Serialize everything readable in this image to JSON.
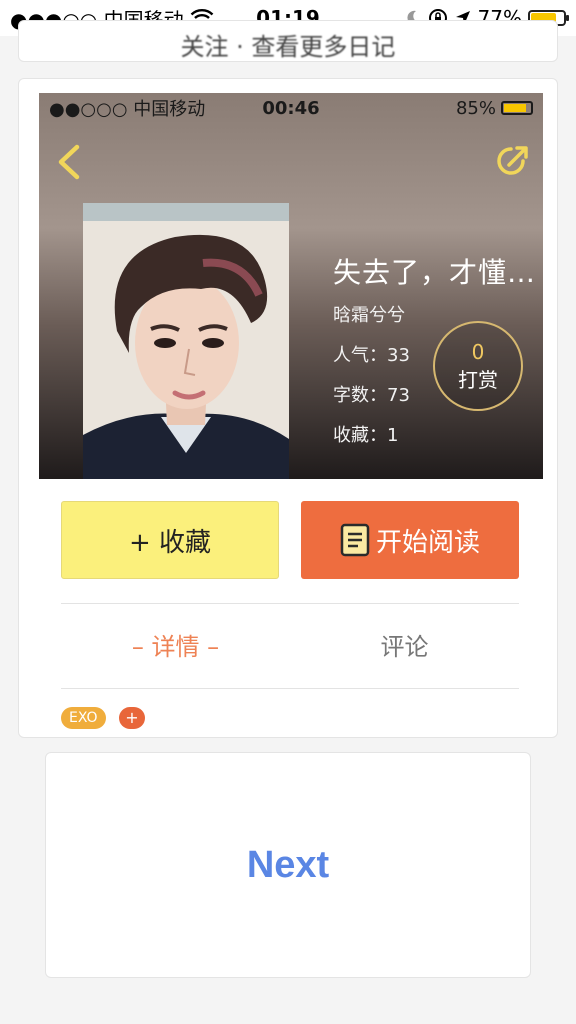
{
  "status_bar": {
    "carrier": "●●●○○ 中国移动",
    "time": "01:19",
    "battery": "77%",
    "battery_level": 0.77
  },
  "top_card": {
    "text": "关注 · 查看更多日记"
  },
  "inner_screenshot": {
    "status_bar": {
      "carrier": "●●○○○ 中国移动",
      "time": "00:46",
      "battery": "85%",
      "battery_level": 0.85
    },
    "book": {
      "title": "失去了，才懂…",
      "author": "晗霜兮兮",
      "popularity_label": "人气：",
      "popularity": "33",
      "words_label": "字数：",
      "words": "73",
      "favorites_label": "收藏：",
      "favorites": "1"
    },
    "reward": {
      "count": "0",
      "label": "打赏"
    }
  },
  "actions": {
    "favorite": "+ 收藏",
    "start_reading": "开始阅读"
  },
  "tabs": {
    "detail": "– 详情 –",
    "comments": "评论"
  },
  "tags": {
    "items": [
      "EXO"
    ],
    "add": "+"
  },
  "next_button": {
    "label": "Next"
  },
  "colors": {
    "favorite_bg": "#fbf07c",
    "read_bg": "#ee6d3f",
    "active_tab": "#ee8254",
    "next_text": "#5a86e4",
    "tag_bg": "#f0ad3c",
    "reward_ring": "#d6b870"
  },
  "icons": {
    "wifi": "wifi-icon",
    "moon": "moon-icon",
    "lock": "rotation-lock-icon",
    "location": "location-arrow-icon",
    "back": "chevron-left-icon",
    "share": "share-icon",
    "book": "book-icon"
  }
}
